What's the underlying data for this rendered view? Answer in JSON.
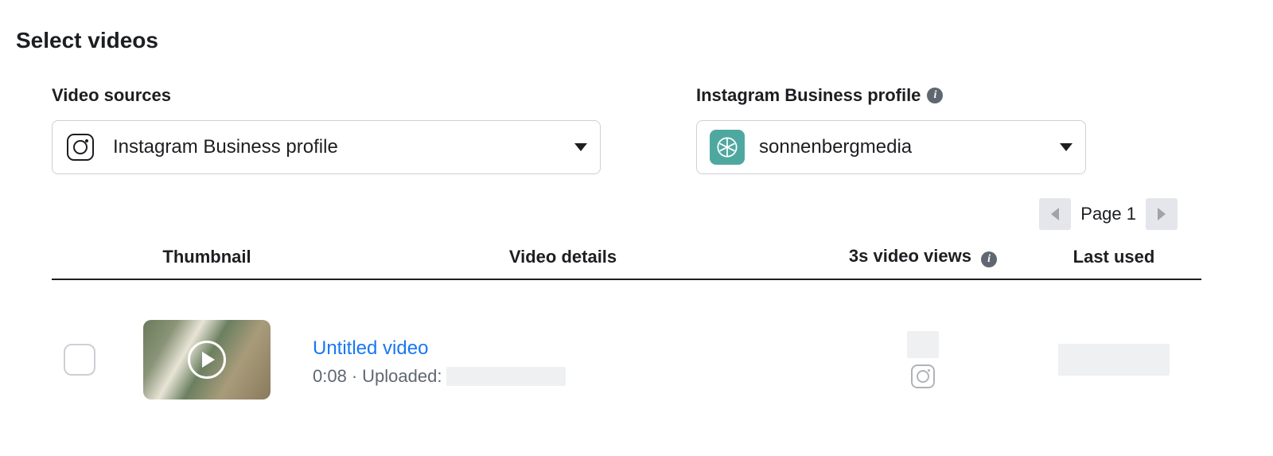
{
  "page_title": "Select videos",
  "controls": {
    "source": {
      "label": "Video sources",
      "selected": "Instagram Business profile"
    },
    "profile": {
      "label": "Instagram Business profile",
      "selected": "sonnenbergmedia"
    }
  },
  "pagination": {
    "label": "Page 1"
  },
  "table": {
    "headers": {
      "thumbnail": "Thumbnail",
      "details": "Video details",
      "views": "3s video views",
      "last_used": "Last used"
    },
    "rows": [
      {
        "title": "Untitled video",
        "duration": "0:08",
        "uploaded_prefix": "Uploaded:"
      }
    ]
  }
}
